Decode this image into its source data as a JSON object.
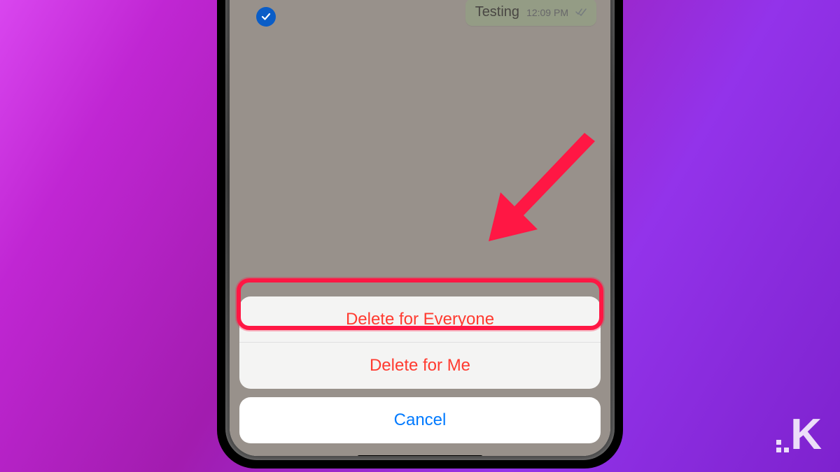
{
  "chat": {
    "message_text": "Testing",
    "message_time": "12:09 PM"
  },
  "action_sheet": {
    "delete_everyone": "Delete for Everyone",
    "delete_me": "Delete for Me",
    "cancel": "Cancel"
  },
  "annotations": {
    "highlight_target": "delete-for-everyone-button",
    "arrow_color": "#ff1744"
  },
  "watermark": {
    "letter": "K"
  }
}
